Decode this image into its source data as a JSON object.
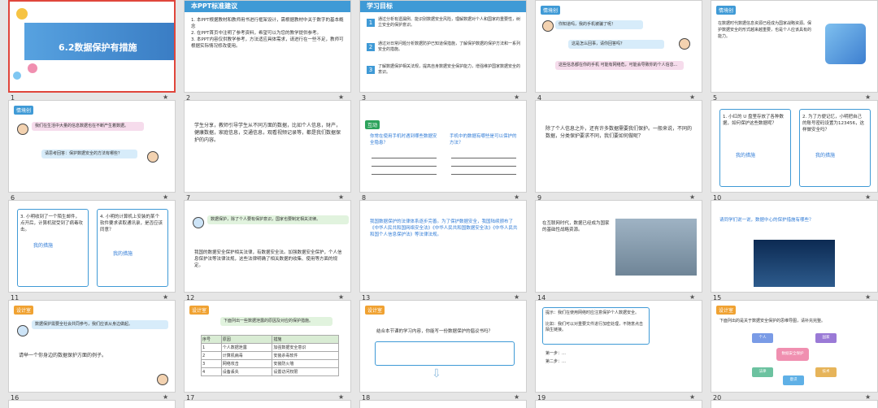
{
  "slides": [
    {
      "num": "1",
      "title": "6.2数据保护有措施"
    },
    {
      "num": "2",
      "header": "本PPT标准建议",
      "lines": [
        "1. 本PPT根据教材和教师用书进行框架设计，需根据教材中关于数字的基本概念",
        "2. 在PPT首页中注明了参考资料，希望可以为您的教学提供参考。",
        "3. 本PPT内容仅供教学参考，方法适应具体需求，请进行在一些不足，教师可根据实际情况修改使用。"
      ]
    },
    {
      "num": "3",
      "header": "学习目标",
      "items": [
        "通过分析有遗漏例、能识别数据安全风险，理解数据对个人和国家的重要性，树立安全的保护意识。",
        "通过对日常问题分析数据防护已知道保措施，了解保护数据的保护方法和一系列安全的措施。",
        "了解数据保护相关法规，提高自身数据安全保护能力，增强维护国家数据安全的意识。"
      ]
    },
    {
      "num": "4",
      "tag": "情境创",
      "bubbles": [
        "你知道吗，我的手机被骗了呢！",
        "这是怎么回事，请你回答吗？",
        "这些信息都在你的手机 可能有网络危，可能会导致你的个人信息..."
      ]
    },
    {
      "num": "5",
      "tag": "情境创",
      "text": "在数据时代数据信息资源已经成为国家战略资源。保护数据安全的形式越来越重要，也是个人应该具有的能力。"
    },
    {
      "num": "6",
      "tag": "情境创",
      "bubbles": [
        "我们在生活中大量的信息数据也在不断产生着数据。"
      ],
      "bubbles2": [
        "请思考回答：保护数据安全的方法有哪些？"
      ]
    },
    {
      "num": "7",
      "text": "学生分享，教师引导学生从不同方面的数据，比如个人信息，财产，健康数据，家庭信息，交通信息，观看视频记录等，都是我们数据保护的内容。"
    },
    {
      "num": "8",
      "tag": "互动",
      "cols": [
        {
          "q": "你常在使用手机时遇到哪些数据安全隐患？",
          "a": ""
        },
        {
          "q": "手机中的数据有哪些是可以保护的方法？",
          "a": ""
        }
      ]
    },
    {
      "num": "9",
      "text": "除了个人信息之外，还有许多数据需要我们保护。一般来说，不同的数据，分类保护要求不同，我们要如何做呢？"
    },
    {
      "num": "10",
      "boxes": [
        "1. 小红的 U 盘里存放了各种数据，如何保护这些数据呢？",
        "2. 为了方便记忆，小明把自己的账号密码设置为123456，这样做安全吗？"
      ],
      "links": [
        "我的措施",
        "我的措施"
      ]
    },
    {
      "num": "11",
      "boxes": [
        "3. 小明收到了一个陌生邮件，点开后，计算机就受到了病毒攻击。",
        "4. 小明的计算机上安装的某个软件要求读取通讯录，是否应该同意？"
      ],
      "links": [
        "我的措施",
        "我的措施"
      ]
    },
    {
      "num": "12",
      "bubbles": [
        "数据保护，除了个人要有保护意识，国家也要制定相关法律。"
      ],
      "text": "我国的数据安全保护相关法律，有数据安全法。加强数据安全保护，个人信息保护法等法律法规，这些法律明确了相关数据的收集、使用等方面的规定。"
    },
    {
      "num": "13",
      "text": "我国数据保护的法律体系逐步完善。为了保护数据安全，我国陆续颁布了《中华人民共和国网络安全法》《中华人民共和国数据安全法》《中华人民共和国个人信息保护法》等法律法规。"
    },
    {
      "num": "14",
      "text": "在互联网时代，数据已经成为国家的基础性战略资源。"
    },
    {
      "num": "15",
      "text": "请同学们说一说，数据中心的保护措施有哪些？"
    },
    {
      "num": "16",
      "tag": "设计室",
      "bubbles": [
        "数据保护需要全社会共同参与，我们应该从身边做起。"
      ],
      "text": "请举一个你身边的数据保护方面的例子。"
    },
    {
      "num": "17",
      "tag": "设计室",
      "title": "下面列出一些数据泄露的原因及对应的保护措施。",
      "headers": [
        "序号",
        "原因",
        "措施"
      ],
      "rows": [
        [
          "1",
          "个人数据泄露",
          "加强数据安全意识"
        ],
        [
          "2",
          "计算机病毒",
          "安装杀毒软件"
        ],
        [
          "3",
          "网络攻击",
          "安装防火墙"
        ],
        [
          "4",
          "设备丢失",
          "设置访问权限"
        ]
      ]
    },
    {
      "num": "18",
      "tag": "设计室",
      "text": "结合本节课的学习内容，你能写一份数据保护的倡议书吗？"
    },
    {
      "num": "19",
      "tag": "设计室",
      "lines": [
        "提示：我们在使用网络时应注意保护个人数据安全。",
        "比如：我们可以对重要文件进行加密处理，不随意点击陌生链接。",
        "第一步：…",
        "第二步：…"
      ]
    },
    {
      "num": "20",
      "tag": "设计室",
      "text": "下面列出的是关于数据安全保护的思维导图，请补充完整。",
      "nodes": [
        "数据安全保护",
        "个人",
        "国家",
        "法律",
        "技术",
        "意识"
      ]
    }
  ]
}
